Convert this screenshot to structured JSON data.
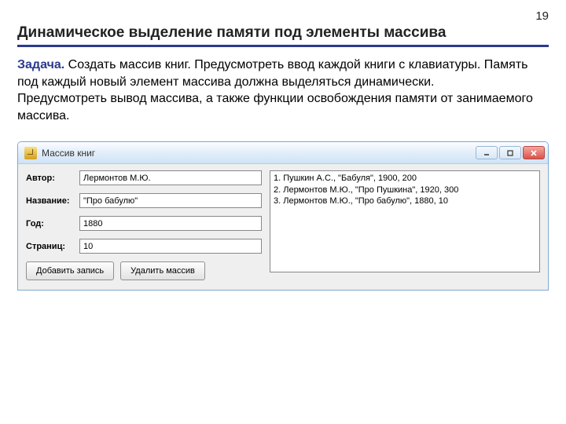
{
  "page_number": "19",
  "heading": "Динамическое выделение памяти под элементы массива",
  "task_label": "Задача.",
  "task_text_1": "  Создать массив книг. Предусмотреть ввод каждой книги с клавиатуры. Память под каждый новый элемент массива должна выделяться динамически.",
  "task_text_2": "Предусмотреть вывод массива, а также функции освобождения памяти от занимаемого массива.",
  "window": {
    "title": "Массив книг",
    "labels": {
      "author": "Автор:",
      "title": "Название:",
      "year": "Год:",
      "pages": "Страниц:"
    },
    "values": {
      "author": "Лермонтов М.Ю.",
      "title": "\"Про бабулю\"",
      "year": "1880",
      "pages": "10"
    },
    "buttons": {
      "add": "Добавить запись",
      "delete": "Удалить массив"
    },
    "list": [
      "1. Пушкин А.С., \"Бабуля\", 1900, 200",
      "2. Лермонтов М.Ю., \"Про Пушкина\", 1920, 300",
      "3. Лермонтов М.Ю., \"Про бабулю\", 1880, 10"
    ]
  }
}
